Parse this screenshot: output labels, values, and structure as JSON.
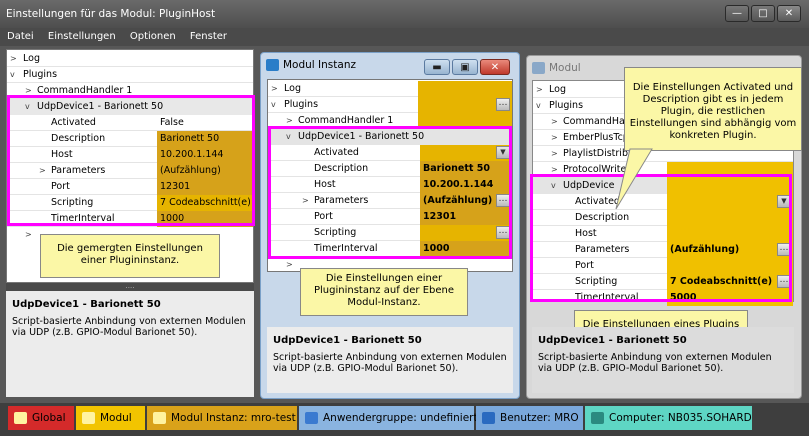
{
  "window": {
    "title": "Einstellungen für das Modul: PluginHost",
    "btn_min": "—",
    "btn_max": "□",
    "btn_close": "✕"
  },
  "menu": [
    "Datei",
    "Einstellungen",
    "Optionen",
    "Fenster"
  ],
  "left": {
    "rows": {
      "log": "Log",
      "plugins": "Plugins",
      "cmd": "CommandHandler 1",
      "udp": "UdpDevice1 - Barionett 50"
    },
    "props": [
      {
        "k": "Activated",
        "v": "False"
      },
      {
        "k": "Description",
        "v": "Barionett 50"
      },
      {
        "k": "Host",
        "v": "10.200.1.144"
      },
      {
        "k": "Parameters",
        "v": "(Aufzählung)"
      },
      {
        "k": "Port",
        "v": "12301"
      },
      {
        "k": "Scripting",
        "v": "7 Codeabschnitt(e)"
      },
      {
        "k": "TimerInterval",
        "v": "1000"
      }
    ],
    "callout": "Die gemergten Einstellungen einer Plugininstanz.",
    "desc_title": "UdpDevice1 - Barionett 50",
    "desc_text": "Script-basierte Anbindung von externen Modulen via UDP (z.B. GPIO-Modul Barionet 50)."
  },
  "middle": {
    "title": "Modul Instanz",
    "rows": {
      "log": "Log",
      "plugins": "Plugins",
      "cmd": "CommandHandler 1",
      "udp": "UdpDevice1 - Barionett 50"
    },
    "props": [
      {
        "k": "Activated",
        "v": ""
      },
      {
        "k": "Description",
        "v": "Barionett 50"
      },
      {
        "k": "Host",
        "v": "10.200.1.144"
      },
      {
        "k": "Parameters",
        "v": "(Aufzählung)"
      },
      {
        "k": "Port",
        "v": "12301"
      },
      {
        "k": "Scripting",
        "v": ""
      },
      {
        "k": "TimerInterval",
        "v": "1000"
      }
    ],
    "callout": "Die Einstellungen einer Plugininstanz auf der Ebene Modul-Instanz.",
    "desc_title": "UdpDevice1 - Barionett 50",
    "desc_text": "Script-basierte Anbindung von externen Modulen via UDP (z.B. GPIO-Modul Barionet 50)."
  },
  "right": {
    "title": "Modul",
    "rows": {
      "log": "Log",
      "plugins": "Plugins",
      "cmd": "CommandHandler",
      "ember": "EmberPlusTcp",
      "playlist": "PlaylistDistribu",
      "protocol": "ProtocolWriter",
      "udp": "UdpDevice"
    },
    "props": [
      {
        "k": "Activated",
        "v": ""
      },
      {
        "k": "Description",
        "v": ""
      },
      {
        "k": "Host",
        "v": ""
      },
      {
        "k": "Parameters",
        "v": "(Aufzählung)"
      },
      {
        "k": "Port",
        "v": ""
      },
      {
        "k": "Scripting",
        "v": "7 Codeabschnitt(e)"
      },
      {
        "k": "TimerInterval",
        "v": "5000"
      }
    ],
    "callout_top": "Die Einstellungen Activated und Description gibt es in jedem Plugin, die restlichen Einstellungen sind abhängig vom konkreten Plugin.",
    "callout_bottom": "Die Einstellungen eines Plugins (dienen als Default-Werte für die Plugininstanzen).",
    "desc_title": "UdpDevice1 - Barionett 50",
    "desc_text": "Script-basierte Anbindung von externen Modulen via UDP (z.B. GPIO-Modul Barionet 50)."
  },
  "status": [
    {
      "label": "Global",
      "color": "#d42a2a"
    },
    {
      "label": "Modul",
      "color": "#f2c400"
    },
    {
      "label": "Modul Instanz: mro-test",
      "color": "#d9a21a"
    },
    {
      "label": "Anwendergruppe: undefiniert",
      "color": "#8ab4e0"
    },
    {
      "label": "Benutzer: MRO",
      "color": "#7aa8dc"
    },
    {
      "label": "Computer: NB035.SOHARD",
      "color": "#5ed6c4"
    }
  ]
}
